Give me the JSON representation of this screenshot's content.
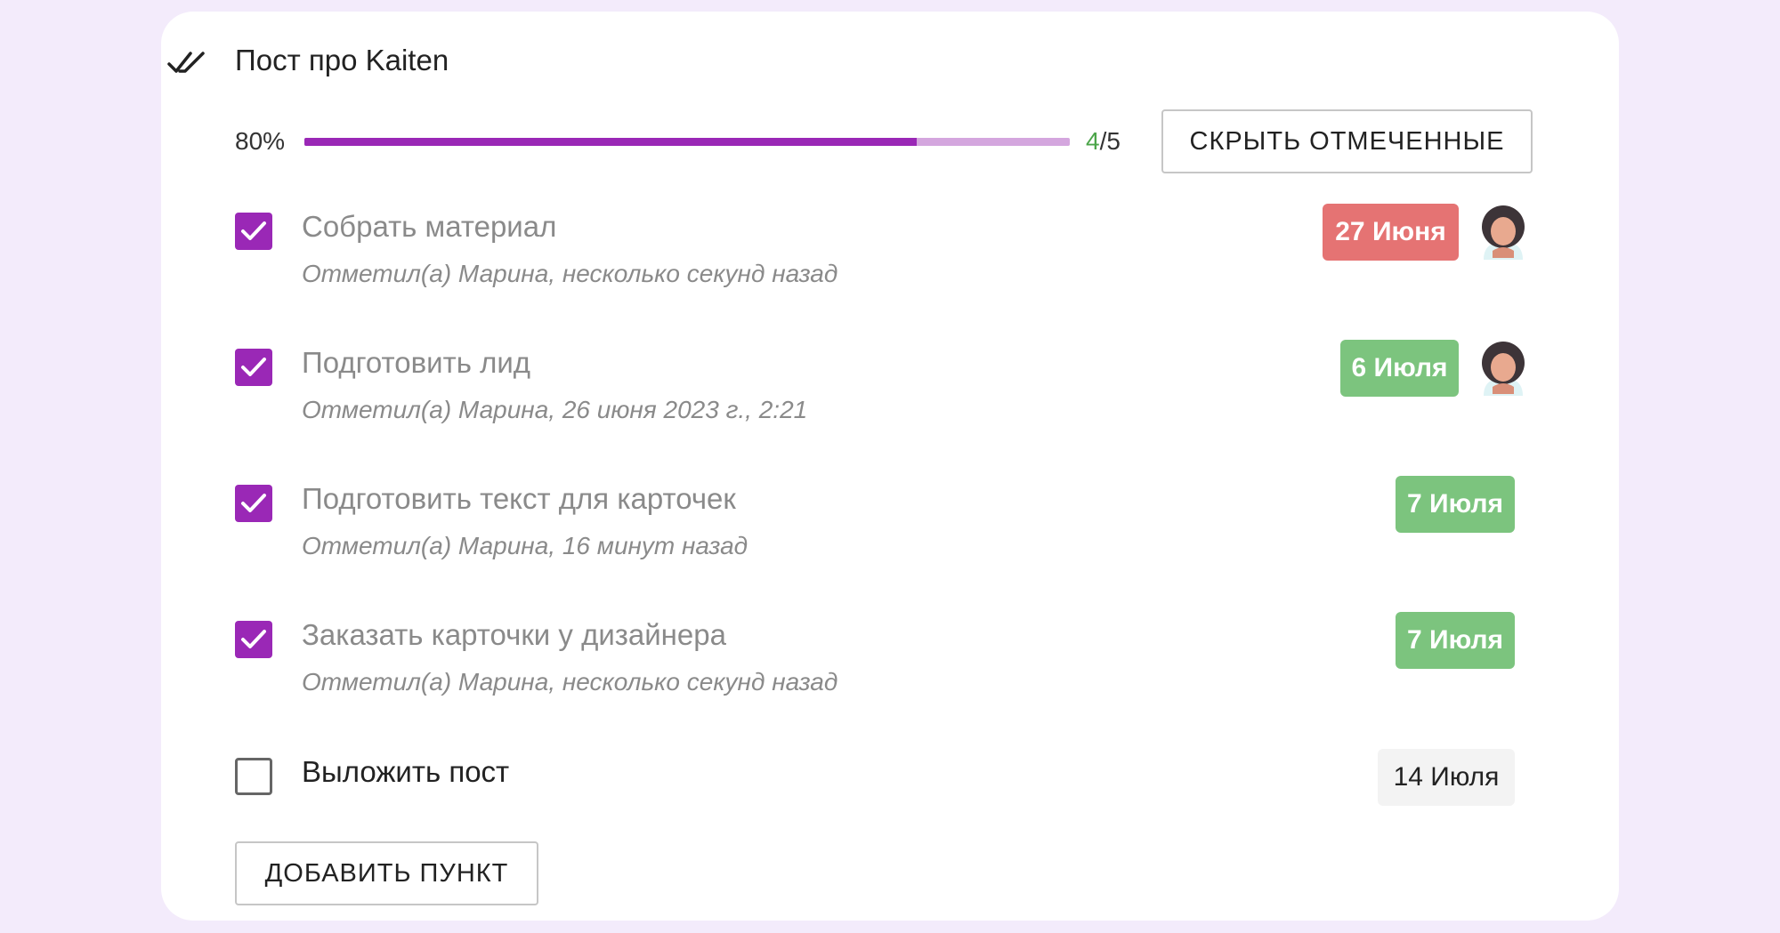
{
  "checklist": {
    "title": "Пост про Kaiten",
    "title_icon": "double-check-icon",
    "progress": {
      "percent_label": "80%",
      "value": 0.8,
      "done": "4",
      "separator": "/",
      "total": "5"
    },
    "hide_checked_label": "СКРЫТЬ ОТМЕЧЕННЫЕ",
    "add_item_label": "ДОБАВИТЬ ПУНКТ",
    "items": [
      {
        "text": "Собрать материал",
        "checked": true,
        "meta": "Отметил(а) Марина, несколько секунд назад",
        "due": "27 Июня",
        "due_status": "overdue",
        "has_avatar": true
      },
      {
        "text": "Подготовить лид",
        "checked": true,
        "meta": "Отметил(а) Марина, 26 июня 2023 г., 2:21",
        "due": "6 Июля",
        "due_status": "ok",
        "has_avatar": true
      },
      {
        "text": "Подготовить текст для карточек",
        "checked": true,
        "meta": "Отметил(а) Марина, 16 минут назад",
        "due": "7 Июля",
        "due_status": "ok",
        "has_avatar": false
      },
      {
        "text": "Заказать карточки у дизайнера",
        "checked": true,
        "meta": "Отметил(а) Марина, несколько секунд назад",
        "due": "7 Июля",
        "due_status": "ok",
        "has_avatar": false
      },
      {
        "text": "Выложить пост",
        "checked": false,
        "meta": "",
        "due": "14 Июля",
        "due_status": "plain",
        "has_avatar": false
      }
    ]
  },
  "colors": {
    "background": "#f3ebfb",
    "accent": "#9a28b6",
    "progress_track": "#d4a6de",
    "overdue": "#e57373",
    "ok": "#7cc47e",
    "neutral_chip": "#f3f3f3",
    "progress_done_count": "#4ca54a"
  }
}
